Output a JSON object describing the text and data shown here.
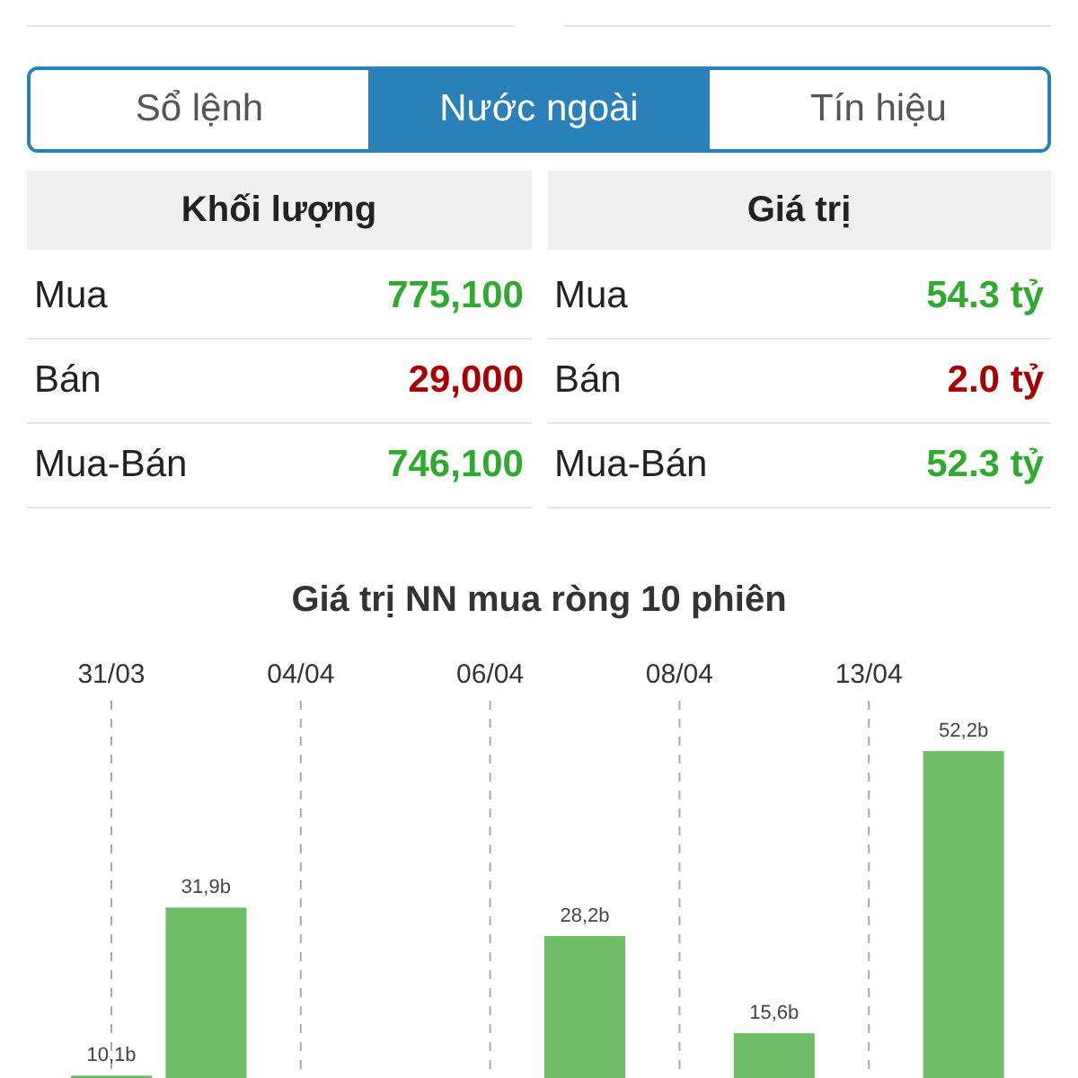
{
  "tabs": [
    {
      "label": "Sổ lệnh",
      "selected": false
    },
    {
      "label": "Nước ngoài",
      "selected": true
    },
    {
      "label": "Tín hiệu",
      "selected": false
    }
  ],
  "tables": [
    {
      "heading": "Khối lượng",
      "rows": [
        {
          "label": "Mua",
          "value": "775,100",
          "color": "#2eab2e"
        },
        {
          "label": "Bán",
          "value": "29,000",
          "color": "#a80000"
        },
        {
          "label": "Mua-Bán",
          "value": "746,100",
          "color": "#2eab2e"
        }
      ]
    },
    {
      "heading": "Giá trị",
      "rows": [
        {
          "label": "Mua",
          "value": "54.3 tỷ",
          "color": "#2eab2e"
        },
        {
          "label": "Bán",
          "value": "2.0 tỷ",
          "color": "#a80000"
        },
        {
          "label": "Mua-Bán",
          "value": "52.3 tỷ",
          "color": "#2eab2e"
        }
      ]
    }
  ],
  "chart": {
    "chart_data": {
      "type": "bar",
      "grid": true,
      "title": "Giá trị NN mua ròng 10 phiên",
      "categories": [
        "31/03",
        null,
        "04/04",
        null,
        "06/04",
        null,
        "08/04",
        null,
        "13/04",
        null
      ],
      "values": [
        10.1,
        31.9,
        null,
        null,
        null,
        28.2,
        null,
        15.6,
        null,
        52.2
      ],
      "value_labels": [
        "10,1b",
        "31,9b",
        null,
        null,
        null,
        "28,2b",
        null,
        "15,6b",
        null,
        "52,2b"
      ]
    }
  }
}
